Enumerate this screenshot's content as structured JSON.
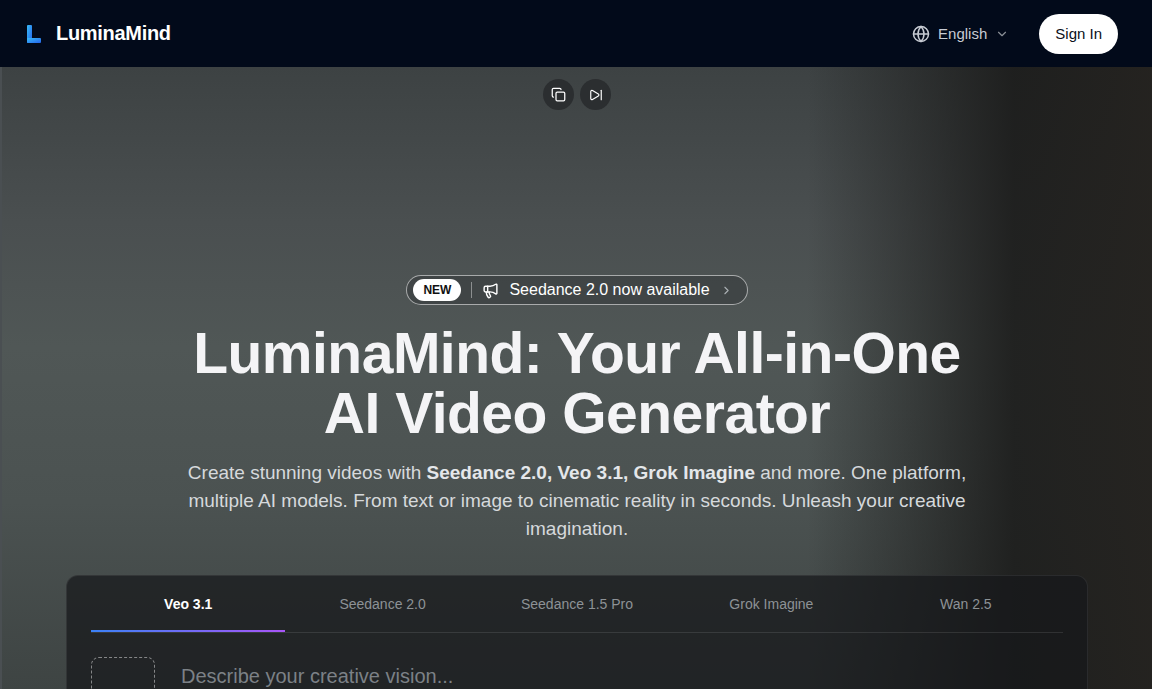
{
  "header": {
    "logo": "LuminaMind",
    "language": "English",
    "sign_in": "Sign In"
  },
  "badge": {
    "label": "NEW",
    "text": "Seedance 2.0 now available"
  },
  "title": [
    "LuminaMind: Your All-in-One",
    "AI Video Generator"
  ],
  "subtitle": [
    {
      "text": "Create stunning videos with ",
      "bold": false
    },
    {
      "text": "Seedance 2.0, Veo 3.1, Grok Imagine",
      "bold": true
    },
    {
      "text": " and more. One platform, multiple AI models. From text or image to cinematic reality in seconds. Unleash your creative imagination.",
      "bold": false
    }
  ],
  "tabs": [
    {
      "label": "Veo 3.1",
      "selected": true
    },
    {
      "label": "Seedance 2.0",
      "selected": false
    },
    {
      "label": "Seedance 1.5 Pro",
      "selected": false
    },
    {
      "label": "Grok Imagine",
      "selected": false
    },
    {
      "label": "Wan 2.5",
      "selected": false
    }
  ],
  "prompt": {
    "placeholder": "Describe your creative vision..."
  }
}
